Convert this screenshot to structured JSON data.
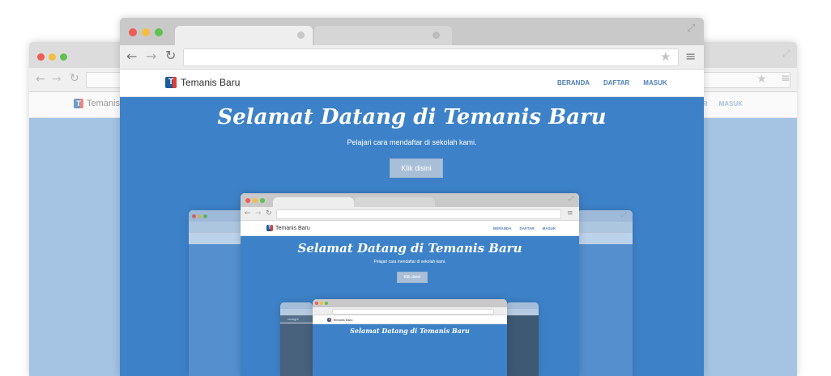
{
  "site": {
    "brand": "Temanis Baru",
    "logo_letter": "T",
    "menu": [
      "BERANDA",
      "DAFTAR",
      "MASUK"
    ],
    "hero_title": "Selamat Datang di Temanis Baru",
    "hero_subtitle": "Pelajari cara mendaftar di sekolah kami.",
    "cta_label": "Klik disini"
  },
  "back_window": {
    "brand_partial": "Temanis",
    "menu_partial": [
      "AR",
      "MASUK"
    ]
  },
  "nested_side": {
    "label": "cnslight"
  },
  "icons": {
    "back": "arrow-left-icon",
    "forward": "arrow-right-icon",
    "reload": "reload-icon",
    "star": "star-icon",
    "menu": "hamburger-icon",
    "expand": "expand-icon"
  },
  "colors": {
    "hero_blue": "#3d82c8",
    "hero_blue_faded": "#a5c3e3",
    "dot_red": "#ee5d55",
    "dot_yellow": "#f5bd3f",
    "dot_green": "#5fc24f"
  }
}
